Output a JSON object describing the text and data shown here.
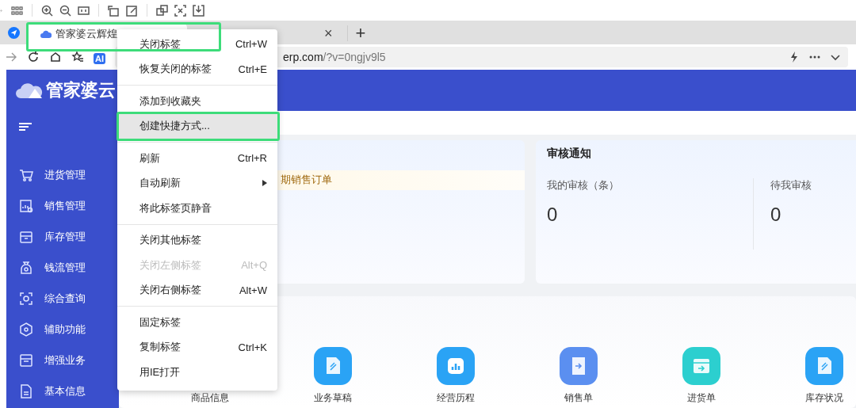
{
  "browser": {
    "tab": {
      "title": "管家婆云辉煌",
      "selected": true
    },
    "close_tab": "×",
    "new_tab": "+",
    "address": "erp.com/?v=0ngjv9l5",
    "ai_badge": "AI"
  },
  "app": {
    "logo": "管家婆云",
    "sidebar": {
      "items": [
        {
          "label": "进货管理"
        },
        {
          "label": "销售管理"
        },
        {
          "label": "库存管理"
        },
        {
          "label": "钱流管理"
        },
        {
          "label": "综合查询"
        },
        {
          "label": "辅助功能"
        },
        {
          "label": "增强业务"
        },
        {
          "label": "基本信息"
        }
      ]
    },
    "notice_card": {
      "banner": "期销售订单"
    },
    "audit_card": {
      "title": "审核通知",
      "stats": [
        {
          "label": "我的审核（条）",
          "value": "0"
        },
        {
          "label": "待我审核",
          "value": "0"
        }
      ]
    },
    "shortcuts": [
      {
        "label": "商品信息"
      },
      {
        "label": "业务草稿",
        "color": "#2aa3f5"
      },
      {
        "label": "经营历程",
        "color": "#2aa3f5"
      },
      {
        "label": "销售单",
        "color": "#5b8ff0"
      },
      {
        "label": "进货单",
        "color": "#2ccfcf"
      },
      {
        "label": "库存状况",
        "color": "#2aa3f5"
      }
    ]
  },
  "context_menu": {
    "groups": [
      [
        {
          "label": "关闭标签",
          "shortcut": "Ctrl+W",
          "disabled": false,
          "selected": false,
          "highlighted": true
        },
        {
          "label": "恢复关闭的标签",
          "shortcut": "Ctrl+E",
          "disabled": false,
          "selected": false
        }
      ],
      [
        {
          "label": "添加到收藏夹",
          "disabled": false,
          "selected": false
        },
        {
          "label": "创建快捷方式...",
          "disabled": false,
          "selected": true,
          "highlighted": true
        }
      ],
      [
        {
          "label": "刷新",
          "shortcut": "Ctrl+R",
          "disabled": false,
          "selected": false
        },
        {
          "label": "自动刷新",
          "disabled": false,
          "selected": false,
          "submenu": true
        },
        {
          "label": "将此标签页静音",
          "disabled": false,
          "selected": false
        }
      ],
      [
        {
          "label": "关闭其他标签",
          "disabled": false,
          "selected": false
        },
        {
          "label": "关闭左侧标签",
          "shortcut": "Alt+Q",
          "disabled": true,
          "selected": false
        },
        {
          "label": "关闭右侧标签",
          "shortcut": "Alt+W",
          "disabled": false,
          "selected": false
        }
      ],
      [
        {
          "label": "固定标签",
          "disabled": false,
          "selected": false
        },
        {
          "label": "复制标签",
          "shortcut": "Ctrl+K",
          "disabled": false,
          "selected": false
        },
        {
          "label": "用IE打开",
          "disabled": false,
          "selected": false
        }
      ]
    ]
  }
}
